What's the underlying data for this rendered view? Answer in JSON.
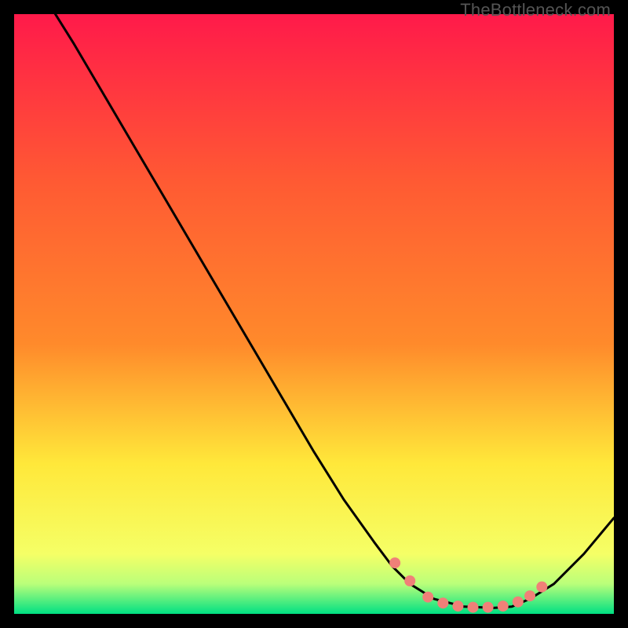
{
  "watermark": "TheBottleneck.com",
  "chart_data": {
    "type": "line",
    "title": "",
    "xlabel": "",
    "ylabel": "",
    "xlim": [
      0,
      100
    ],
    "ylim": [
      0,
      100
    ],
    "grid": false,
    "legend": false,
    "background_gradient": {
      "top": "#ff1a4a",
      "mid_upper": "#ff8a2b",
      "mid": "#ffe83a",
      "mid_lower": "#f5ff66",
      "band": "#baff7a",
      "bottom": "#00e083"
    },
    "series": [
      {
        "name": "bottleneck-curve",
        "color": "#000000",
        "x": [
          0,
          5,
          10,
          15,
          20,
          25,
          30,
          35,
          40,
          45,
          50,
          55,
          60,
          63,
          66,
          70,
          75,
          80,
          83,
          86,
          90,
          95,
          100
        ],
        "y": [
          110,
          103,
          95,
          86.5,
          78,
          69.5,
          61,
          52.5,
          44,
          35.5,
          27,
          19,
          12,
          8,
          5,
          2.5,
          1.2,
          1.0,
          1.2,
          2.5,
          5,
          10,
          16
        ]
      }
    ],
    "markers": {
      "name": "highlight-dots",
      "color": "#f08078",
      "radius_px": 7,
      "x": [
        63.5,
        66,
        69,
        71.5,
        74,
        76.5,
        79,
        81.5,
        84,
        86,
        88
      ],
      "y": [
        8.5,
        5.5,
        2.8,
        1.8,
        1.3,
        1.1,
        1.1,
        1.3,
        2.0,
        3.0,
        4.5
      ]
    }
  }
}
